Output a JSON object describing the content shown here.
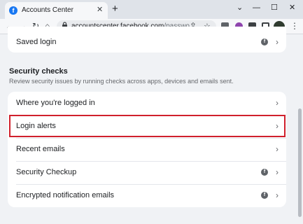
{
  "browser": {
    "tab_title": "Accounts Center",
    "tab_favicon": "f",
    "tab_close": "✕",
    "new_tab": "+",
    "url_host": "accountscenter.facebook.com",
    "url_path": "/passwo...",
    "window_buttons": {
      "dropdown": "⌄",
      "minimize": "—",
      "maximize": "☐",
      "close": "✕"
    },
    "nav": {
      "back": "←",
      "forward": "→",
      "reload": "↻",
      "home": "⌂",
      "lock": "🔒",
      "share": "⇪",
      "star": "☆",
      "more": "⋮"
    }
  },
  "top_card": {
    "label": "Saved login",
    "badge": "f",
    "chevron": "›"
  },
  "security_checks": {
    "title": "Security checks",
    "description": "Review security issues by running checks across apps, devices and emails sent.",
    "items": [
      {
        "label": "Where you're logged in",
        "badge": "",
        "chevron": "›"
      },
      {
        "label": "Login alerts",
        "badge": "",
        "chevron": "›",
        "highlighted": true
      },
      {
        "label": "Recent emails",
        "badge": "",
        "chevron": "›"
      },
      {
        "label": "Security Checkup",
        "badge": "f",
        "chevron": "›"
      },
      {
        "label": "Encrypted notification emails",
        "badge": "f",
        "chevron": "›"
      }
    ]
  },
  "colors": {
    "highlight": "#d0202c",
    "brand": "#1877f2",
    "page_background": "#f0f2f5"
  }
}
